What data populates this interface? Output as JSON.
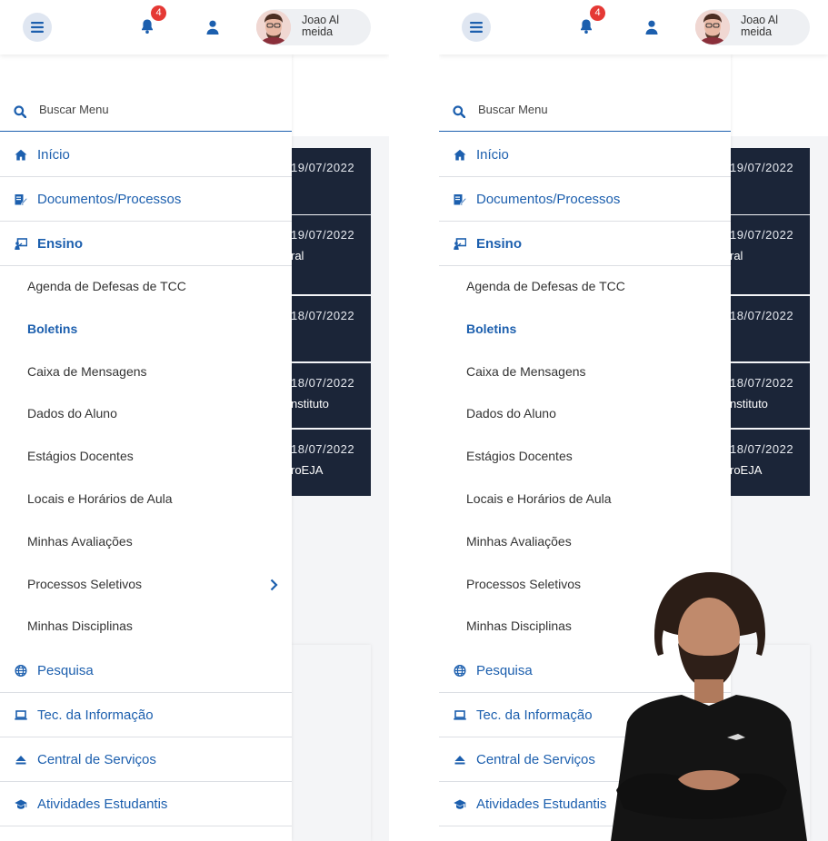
{
  "header": {
    "notification_count": "4",
    "user_name": "Joao Almeida"
  },
  "search": {
    "placeholder": "Buscar Menu"
  },
  "menu": {
    "items_top": [
      {
        "label": "Início",
        "icon": "home-icon"
      },
      {
        "label": "Documentos/Processos",
        "icon": "edit-document-icon"
      },
      {
        "label": "Ensino",
        "icon": "teacher-board-icon",
        "active": true
      }
    ],
    "ensino_sub": [
      {
        "label": "Agenda de Defesas de TCC"
      },
      {
        "label": "Boletins",
        "active": true
      },
      {
        "label": "Caixa de Mensagens"
      },
      {
        "label": "Dados do Aluno"
      },
      {
        "label": "Estágios Docentes"
      },
      {
        "label": "Locais e Horários de Aula"
      },
      {
        "label": "Minhas Avaliações"
      },
      {
        "label": "Processos Seletivos",
        "has_submenu": true
      },
      {
        "label": "Minhas Disciplinas"
      }
    ],
    "items_bottom": [
      {
        "label": "Pesquisa",
        "icon": "globe-icon"
      },
      {
        "label": "Tec. da Informação",
        "icon": "laptop-icon"
      },
      {
        "label": "Central de Serviços",
        "icon": "eject-icon"
      },
      {
        "label": "Atividades Estudantis",
        "icon": "graduation-cap-icon"
      }
    ]
  },
  "news": [
    {
      "date": "19/07/2022",
      "tail": ""
    },
    {
      "date": "19/07/2022",
      "tail": "ral"
    },
    {
      "date": "18/07/2022",
      "tail": ""
    },
    {
      "date": "18/07/2022",
      "tail": "nstituto"
    },
    {
      "date": "18/07/2022",
      "tail": "roEJA"
    }
  ],
  "colors": {
    "accent": "#1c5fae",
    "news_card_bg": "#1b2538",
    "badge": "#e53935"
  }
}
